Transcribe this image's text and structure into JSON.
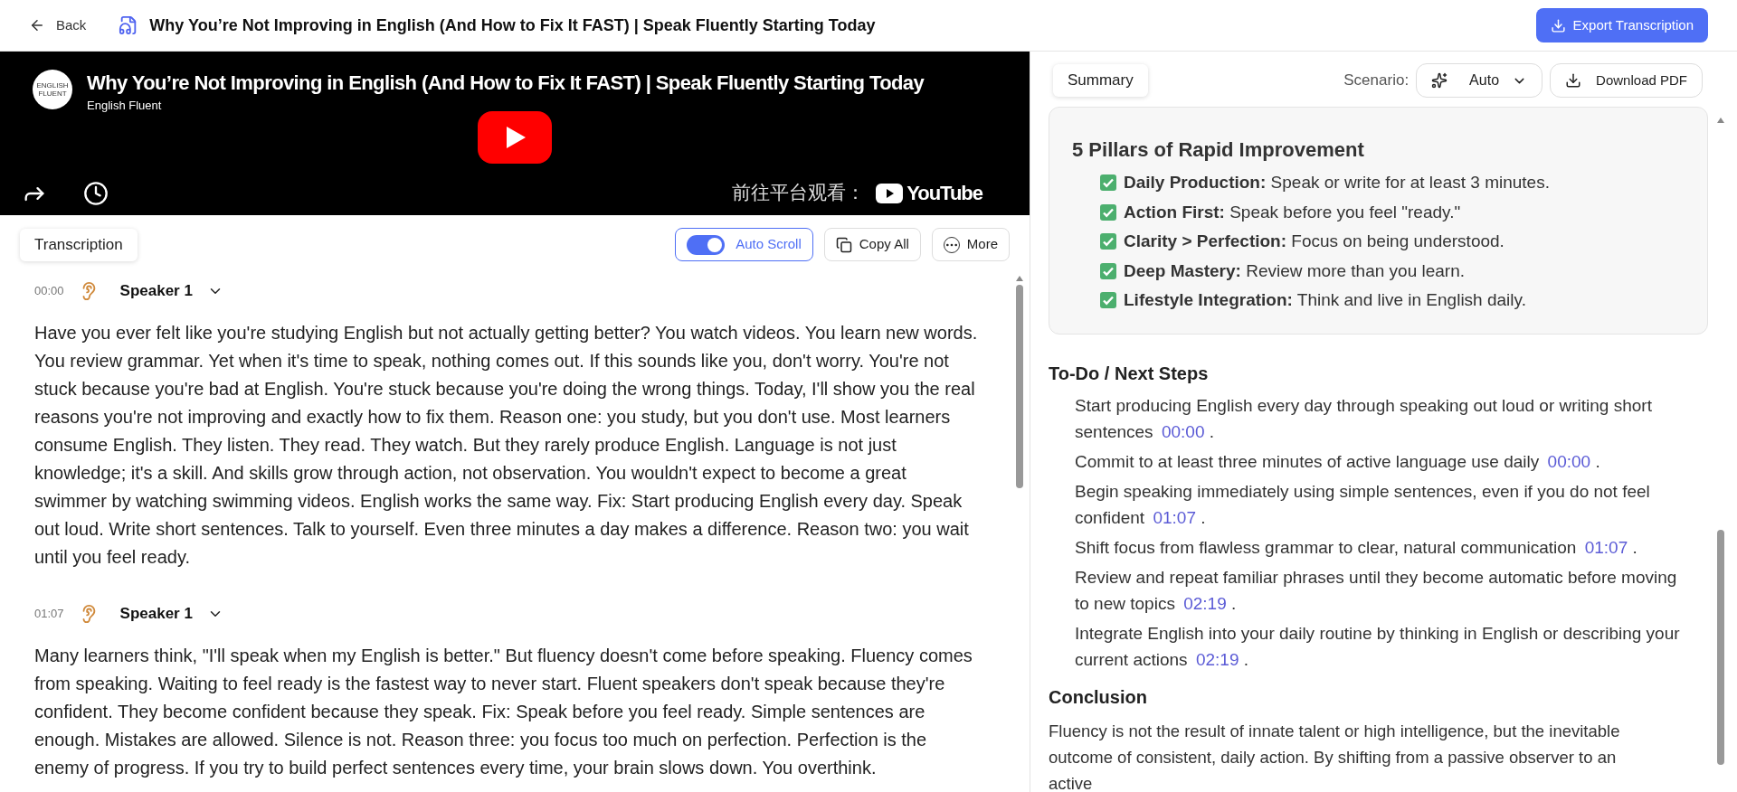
{
  "header": {
    "back": "Back",
    "title": "Why You’re Not Improving in English (And How to Fix It FAST) | Speak Fluently Starting Today",
    "export": "Export Transcription"
  },
  "video": {
    "title": "Why You’re Not Improving in English (And How to Fix It FAST) | Speak Fluently Starting Today",
    "channel": "English Fluent",
    "avatar_text": "ENGLISH FLUENT",
    "watch_on": "前往平台观看：",
    "platform": "YouTube"
  },
  "transcription": {
    "tab": "Transcription",
    "auto_scroll": {
      "label": "Auto Scroll",
      "on": true
    },
    "copy_all": "Copy All",
    "more": "More",
    "segments": [
      {
        "time": "00:00",
        "speaker": "Speaker 1",
        "text": "Have you ever felt like you're studying English but not actually getting better? You watch videos. You learn new words. You review grammar. Yet when it's time to speak, nothing comes out. If this sounds like you, don't worry. You're not stuck because you're bad at English. You're stuck because you're doing the wrong things. Today, I'll show you the real reasons you're not improving and exactly how to fix them. Reason one: you study, but you don't use. Most learners consume English. They listen. They read. They watch. But they rarely produce English. Language is not just knowledge; it's a skill. And skills grow through action, not observation. You wouldn't expect to become a great swimmer by watching swimming videos. English works the same way. Fix: Start producing English every day. Speak out loud. Write short sentences. Talk to yourself. Even three minutes a day makes a difference. Reason two: you wait until you feel ready."
      },
      {
        "time": "01:07",
        "speaker": "Speaker 1",
        "text": "Many learners think, \"I'll speak when my English is better.\" But fluency doesn't come before speaking. Fluency comes from speaking. Waiting to feel ready is the fastest way to never start. Fluent speakers don't speak because they're confident. They become confident because they speak. Fix: Speak before you feel ready. Simple sentences are enough. Mistakes are allowed. Silence is not. Reason three: you focus too much on perfection. Perfection is the enemy of progress. If you try to build perfect sentences every time, your brain slows down. You overthink."
      }
    ]
  },
  "summary": {
    "tab": "Summary",
    "scenario_label": "Scenario:",
    "scenario": "Auto",
    "download": "Download PDF",
    "pillars": {
      "title": "5 Pillars of Rapid Improvement",
      "items": [
        {
          "term": "Daily Production:",
          "text": "Speak or write for at least 3 minutes."
        },
        {
          "term": "Action First:",
          "text": "Speak before you feel \"ready.\""
        },
        {
          "term": "Clarity > Perfection:",
          "text": "Focus on being understood."
        },
        {
          "term": "Deep Mastery:",
          "text": "Review more than you learn."
        },
        {
          "term": "Lifestyle Integration:",
          "text": "Think and live in English daily."
        }
      ]
    },
    "todo": {
      "title": "To-Do / Next Steps",
      "items": [
        {
          "text": "Start producing English every day through speaking out loud or writing short sentences",
          "time": "00:00",
          "end": "."
        },
        {
          "text": "Commit to at least three minutes of active language use daily",
          "time": "00:00",
          "end": "."
        },
        {
          "text": "Begin speaking immediately using simple sentences, even if you do not feel confident",
          "time": "01:07",
          "end": "."
        },
        {
          "text": "Shift focus from flawless grammar to clear, natural communication",
          "time": "01:07",
          "end": "."
        },
        {
          "text": "Review and repeat familiar phrases until they become automatic before moving to new topics",
          "time": "02:19",
          "end": "."
        },
        {
          "text": "Integrate English into your daily routine by thinking in English or describing your current actions",
          "time": "02:19",
          "end": "."
        }
      ]
    },
    "conclusion": {
      "title": "Conclusion",
      "text": "Fluency is not the result of innate talent or high intelligence, but the inevitable outcome of consistent, daily action. By shifting from a passive observer to an active"
    }
  }
}
